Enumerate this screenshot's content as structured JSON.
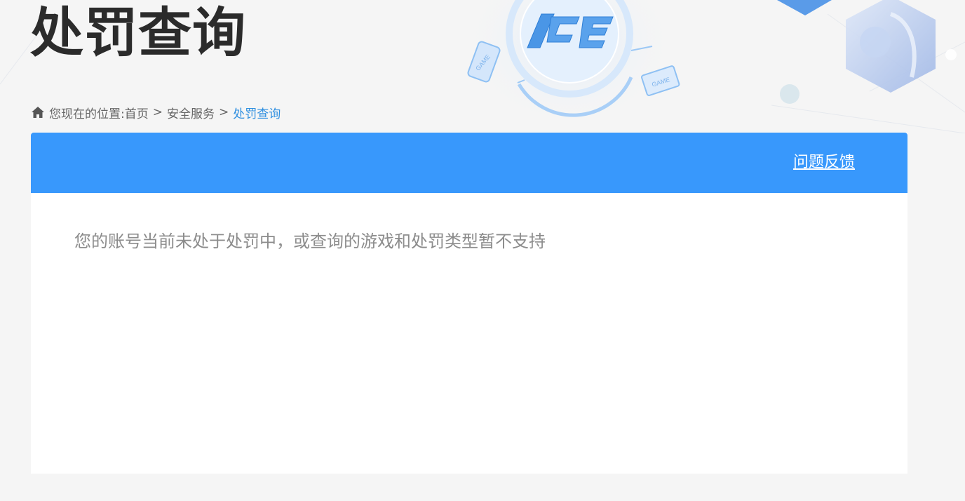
{
  "page": {
    "title": "处罚查询"
  },
  "hero": {
    "logo_text": "ACE",
    "game_badge": "GAME"
  },
  "breadcrumb": {
    "prefix": "您现在的位置:",
    "items": [
      "首页",
      "安全服务"
    ],
    "separator": ">",
    "current": "处罚查询"
  },
  "panel": {
    "feedback_label": "问题反馈",
    "message": "您的账号当前未处于处罚中，或查询的游戏和处罚类型暂不支持"
  },
  "colors": {
    "header_blue": "#3898fc",
    "breadcrumb_current": "#2f8fe0",
    "title_text": "#2b2b2b",
    "message_text": "#8c8c8c"
  },
  "icons": {
    "breadcrumb": "home-icon",
    "hero_logo": "ace-logo",
    "hero_device": "game-device-icon",
    "hero_avatar": "character-avatar"
  }
}
